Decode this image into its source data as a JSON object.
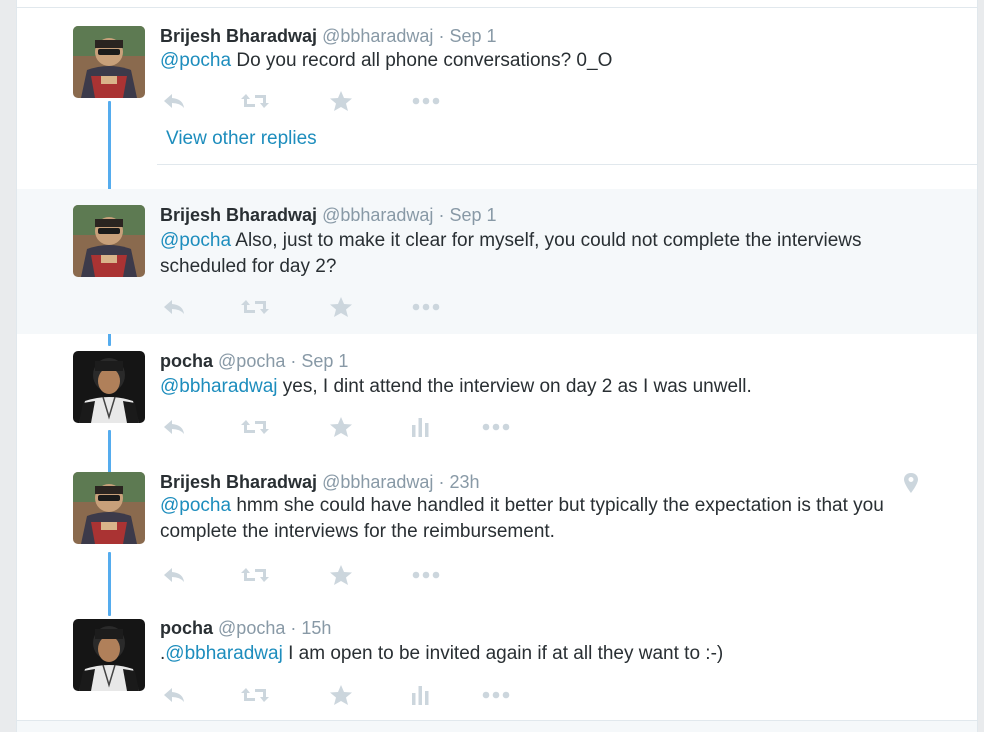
{
  "colors": {
    "link": "#1d8dbd",
    "thread": "#55acee",
    "icon": "#ccd6dd",
    "muted": "#8899a6"
  },
  "view_other_replies": "View other replies",
  "tweets": [
    {
      "name": "Brijesh Bharadwaj",
      "handle": "@bbharadwaj",
      "sep": "·",
      "time": "Sep 1",
      "mention": "@pocha",
      "text": " Do you record all phone conversations? 0_O"
    },
    {
      "name": "Brijesh Bharadwaj",
      "handle": "@bbharadwaj",
      "sep": "·",
      "time": "Sep 1",
      "mention": "@pocha",
      "text": " Also, just to make it clear for myself, you could not complete the interviews scheduled for day 2?"
    },
    {
      "name": "pocha",
      "handle": "@pocha",
      "sep": "·",
      "time": "Sep 1",
      "mention": "@bbharadwaj",
      "text": " yes, I dint attend the interview on day 2 as I was unwell."
    },
    {
      "name": "Brijesh Bharadwaj",
      "handle": "@bbharadwaj",
      "sep": "·",
      "time": "23h",
      "mention": "@pocha",
      "text": " hmm she could have handled it better but typically the expectation is that you complete the interviews for the reimbursement."
    },
    {
      "name": "pocha",
      "handle": "@pocha",
      "sep": "·",
      "time": "15h",
      "prefix": ".",
      "mention": "@bbharadwaj",
      "text": " I am open to be invited again if at all they want to :-)"
    }
  ],
  "icons": {
    "reply": "reply-icon",
    "retweet": "retweet-icon",
    "favorite": "star-icon",
    "analytics": "analytics-icon",
    "more": "more-icon",
    "location": "location-pin-icon"
  }
}
